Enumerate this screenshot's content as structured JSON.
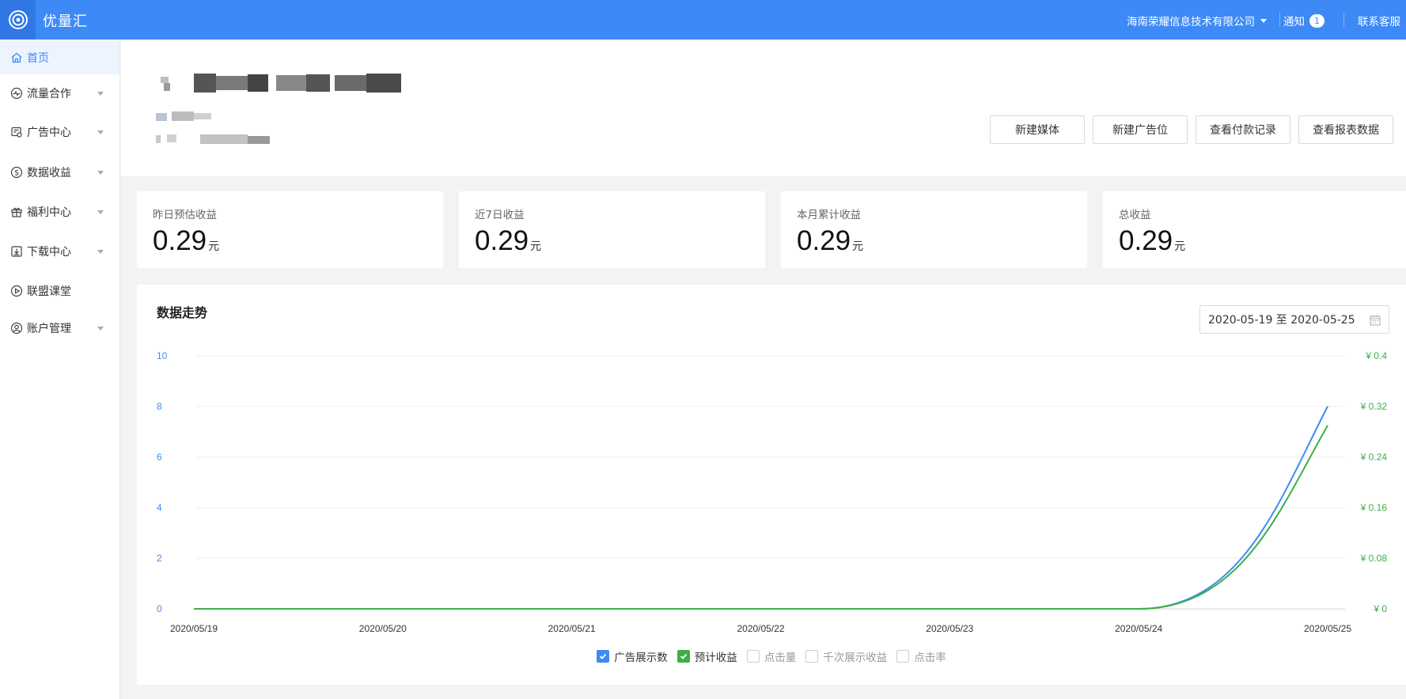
{
  "header": {
    "app_title": "优量汇",
    "company": "海南荣耀信息技术有限公司",
    "notice_label": "通知",
    "notice_count": "1",
    "service_label": "联系客服"
  },
  "sidebar": {
    "items": [
      {
        "label": "首页",
        "icon": "home-icon",
        "active": true
      },
      {
        "label": "流量合作",
        "icon": "pulse-icon"
      },
      {
        "label": "广告中心",
        "icon": "ad-icon"
      },
      {
        "label": "数据收益",
        "icon": "dollar-icon"
      },
      {
        "label": "福利中心",
        "icon": "gift-icon"
      },
      {
        "label": "下载中心",
        "icon": "download-icon"
      },
      {
        "label": "联盟课堂",
        "icon": "play-icon"
      },
      {
        "label": "账户管理",
        "icon": "user-icon"
      }
    ]
  },
  "actions": {
    "new_media": "新建媒体",
    "new_slot": "新建广告位",
    "payment_records": "查看付款记录",
    "report_data": "查看报表数据"
  },
  "stats": [
    {
      "label": "昨日预估收益",
      "value": "0.29",
      "unit": "元"
    },
    {
      "label": "近7日收益",
      "value": "0.29",
      "unit": "元"
    },
    {
      "label": "本月累计收益",
      "value": "0.29",
      "unit": "元"
    },
    {
      "label": "总收益",
      "value": "0.29",
      "unit": "元"
    }
  ],
  "trend": {
    "title": "数据走势",
    "date_range": "2020-05-19 至 2020-05-25"
  },
  "legend": [
    {
      "label": "广告展示数",
      "checked": true,
      "color": "#3d8af7"
    },
    {
      "label": "预计收益",
      "checked": true,
      "color": "#3fae48"
    },
    {
      "label": "点击量",
      "checked": false
    },
    {
      "label": "千次展示收益",
      "checked": false
    },
    {
      "label": "点击率",
      "checked": false
    }
  ],
  "chart_data": {
    "type": "line",
    "x": [
      "2020/05/19",
      "2020/05/20",
      "2020/05/21",
      "2020/05/22",
      "2020/05/23",
      "2020/05/24",
      "2020/05/25"
    ],
    "y_left_ticks": [
      "0",
      "2",
      "4",
      "6",
      "8",
      "10"
    ],
    "y_right_ticks": [
      "¥ 0",
      "¥ 0.08",
      "¥ 0.16",
      "¥ 0.24",
      "¥ 0.32",
      "¥ 0.4"
    ],
    "ylim_left": [
      0,
      10
    ],
    "ylim_right": [
      0,
      0.4
    ],
    "series": [
      {
        "name": "广告展示数",
        "axis": "left",
        "values": [
          0,
          0,
          0,
          0,
          0,
          0,
          8
        ],
        "color": "#3d8af7"
      },
      {
        "name": "预计收益",
        "axis": "right",
        "values": [
          0,
          0,
          0,
          0,
          0,
          0,
          0.29
        ],
        "color": "#3fae48"
      }
    ],
    "grid": true
  }
}
